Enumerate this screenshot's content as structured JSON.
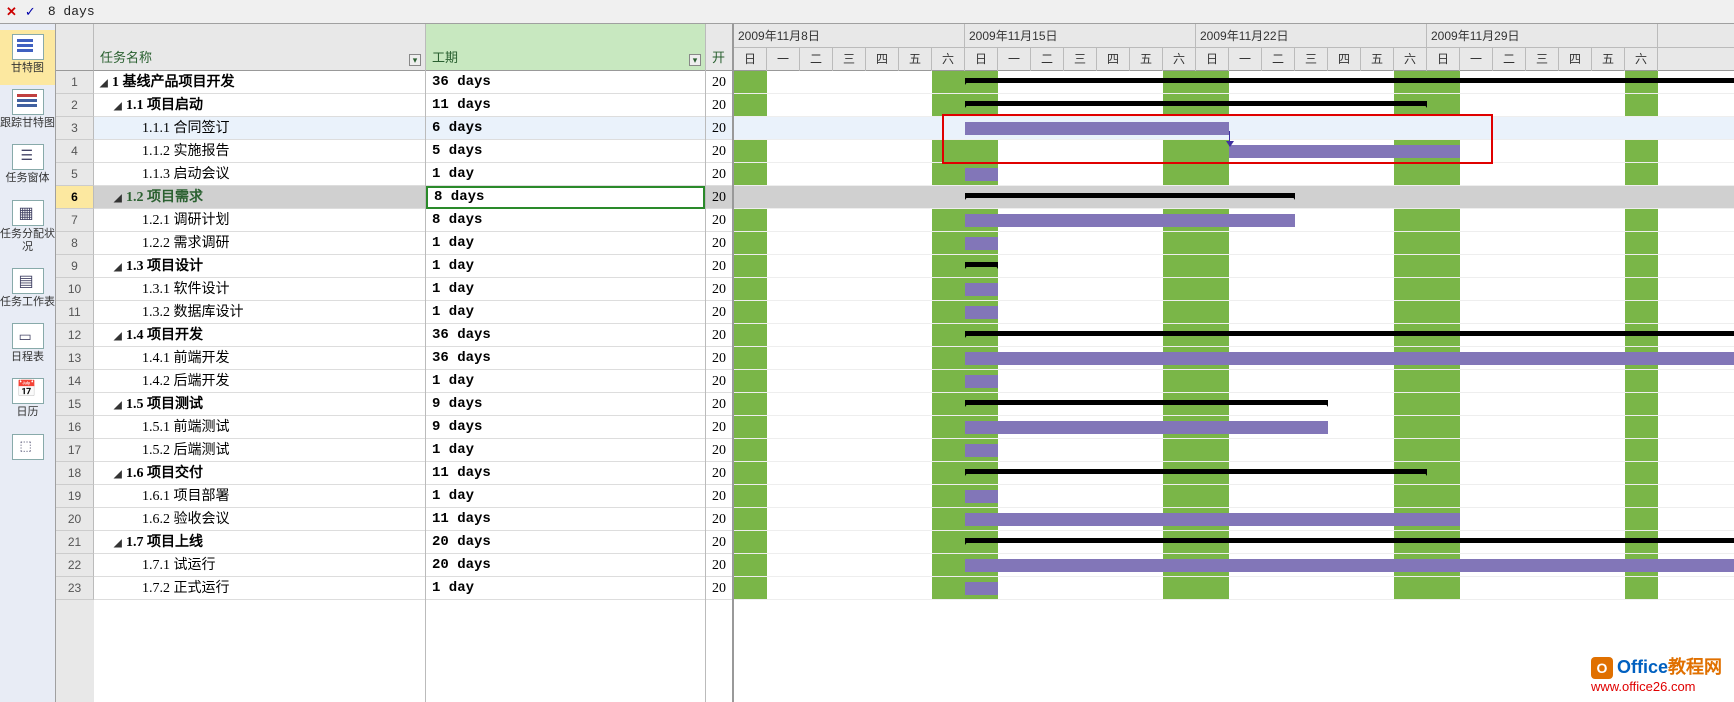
{
  "formula_bar": {
    "cancel": "✕",
    "confirm": "✓",
    "value": "8 days"
  },
  "sidebar": {
    "items": [
      {
        "label": "甘特图"
      },
      {
        "label": "跟踪甘特图"
      },
      {
        "label": "任务窗体"
      },
      {
        "label": "任务分配状况"
      },
      {
        "label": "任务工作表"
      },
      {
        "label": "日程表"
      },
      {
        "label": "日历"
      },
      {
        "label": ""
      }
    ]
  },
  "columns": {
    "name": "任务名称",
    "duration": "工期",
    "start": "开"
  },
  "timeline": {
    "weeks": [
      "2009年11月8日",
      "2009年11月15日",
      "2009年11月22日",
      "2009年11月29日"
    ],
    "days": [
      "日",
      "一",
      "二",
      "三",
      "四",
      "五",
      "六"
    ]
  },
  "selected_row": 6,
  "highlight_row": 3,
  "tasks": [
    {
      "row": 1,
      "wbs": "1",
      "name": "基线产品项目开发",
      "dur": "36 days",
      "start": "20",
      "level": 0,
      "summary": true,
      "bar": [
        7,
        39
      ]
    },
    {
      "row": 2,
      "wbs": "1.1",
      "name": "项目启动",
      "dur": "11 days",
      "start": "20",
      "level": 1,
      "summary": true,
      "bar": [
        7,
        21
      ]
    },
    {
      "row": 3,
      "wbs": "1.1.1",
      "name": "合同签订",
      "dur": "6 days",
      "start": "20",
      "level": 2,
      "summary": false,
      "bar": [
        7,
        15
      ]
    },
    {
      "row": 4,
      "wbs": "1.1.2",
      "name": "实施报告",
      "dur": "5 days",
      "start": "20",
      "level": 2,
      "summary": false,
      "bar": [
        15,
        22
      ]
    },
    {
      "row": 5,
      "wbs": "1.1.3",
      "name": "启动会议",
      "dur": "1 day",
      "start": "20",
      "level": 2,
      "summary": false,
      "bar": [
        7,
        8
      ]
    },
    {
      "row": 6,
      "wbs": "1.2",
      "name": "项目需求",
      "dur": "8 days",
      "start": "20",
      "level": 1,
      "summary": true,
      "bar": [
        7,
        17
      ]
    },
    {
      "row": 7,
      "wbs": "1.2.1",
      "name": "调研计划",
      "dur": "8 days",
      "start": "20",
      "level": 2,
      "summary": false,
      "bar": [
        7,
        17
      ]
    },
    {
      "row": 8,
      "wbs": "1.2.2",
      "name": "需求调研",
      "dur": "1 day",
      "start": "20",
      "level": 2,
      "summary": false,
      "bar": [
        7,
        8
      ]
    },
    {
      "row": 9,
      "wbs": "1.3",
      "name": "项目设计",
      "dur": "1 day",
      "start": "20",
      "level": 1,
      "summary": true,
      "bar": [
        7,
        8
      ]
    },
    {
      "row": 10,
      "wbs": "1.3.1",
      "name": "软件设计",
      "dur": "1 day",
      "start": "20",
      "level": 2,
      "summary": false,
      "bar": [
        7,
        8
      ]
    },
    {
      "row": 11,
      "wbs": "1.3.2",
      "name": "数据库设计",
      "dur": "1 day",
      "start": "20",
      "level": 2,
      "summary": false,
      "bar": [
        7,
        8
      ]
    },
    {
      "row": 12,
      "wbs": "1.4",
      "name": "项目开发",
      "dur": "36 days",
      "start": "20",
      "level": 1,
      "summary": true,
      "bar": [
        7,
        39
      ]
    },
    {
      "row": 13,
      "wbs": "1.4.1",
      "name": "前端开发",
      "dur": "36 days",
      "start": "20",
      "level": 2,
      "summary": false,
      "bar": [
        7,
        39
      ]
    },
    {
      "row": 14,
      "wbs": "1.4.2",
      "name": "后端开发",
      "dur": "1 day",
      "start": "20",
      "level": 2,
      "summary": false,
      "bar": [
        7,
        8
      ]
    },
    {
      "row": 15,
      "wbs": "1.5",
      "name": "项目测试",
      "dur": "9 days",
      "start": "20",
      "level": 1,
      "summary": true,
      "bar": [
        7,
        18
      ]
    },
    {
      "row": 16,
      "wbs": "1.5.1",
      "name": "前端测试",
      "dur": "9 days",
      "start": "20",
      "level": 2,
      "summary": false,
      "bar": [
        7,
        18
      ]
    },
    {
      "row": 17,
      "wbs": "1.5.2",
      "name": "后端测试",
      "dur": "1 day",
      "start": "20",
      "level": 2,
      "summary": false,
      "bar": [
        7,
        8
      ]
    },
    {
      "row": 18,
      "wbs": "1.6",
      "name": "项目交付",
      "dur": "11 days",
      "start": "20",
      "level": 1,
      "summary": true,
      "bar": [
        7,
        21
      ]
    },
    {
      "row": 19,
      "wbs": "1.6.1",
      "name": "项目部署",
      "dur": "1 day",
      "start": "20",
      "level": 2,
      "summary": false,
      "bar": [
        7,
        8
      ]
    },
    {
      "row": 20,
      "wbs": "1.6.2",
      "name": "验收会议",
      "dur": "11 days",
      "start": "20",
      "level": 2,
      "summary": false,
      "bar": [
        7,
        22
      ]
    },
    {
      "row": 21,
      "wbs": "1.7",
      "name": "项目上线",
      "dur": "20 days",
      "start": "20",
      "level": 1,
      "summary": true,
      "bar": [
        7,
        33
      ]
    },
    {
      "row": 22,
      "wbs": "1.7.1",
      "name": "试运行",
      "dur": "20 days",
      "start": "20",
      "level": 2,
      "summary": false,
      "bar": [
        7,
        33
      ]
    },
    {
      "row": 23,
      "wbs": "1.7.2",
      "name": "正式运行",
      "dur": "1 day",
      "start": "20",
      "level": 2,
      "summary": false,
      "bar": [
        7,
        8
      ]
    }
  ],
  "weekend_cols": [
    0,
    6,
    7,
    13,
    14,
    20,
    21,
    27
  ],
  "link": {
    "from_row": 3,
    "to_row": 4,
    "col": 15
  },
  "redbox": {
    "top_row": 3,
    "bottom_row": 4,
    "left_col": 6.3,
    "right_col": 23
  },
  "watermark": {
    "brand1": "Office",
    "brand2": "教程网",
    "url": "www.office26.com"
  },
  "chart_data": {
    "type": "gantt",
    "title": "基线产品项目开发",
    "x_unit": "day index from 2009-11-08",
    "tasks": [
      {
        "id": "1",
        "name": "基线产品项目开发",
        "start": 7,
        "end": 39,
        "summary": true
      },
      {
        "id": "1.1",
        "name": "项目启动",
        "start": 7,
        "end": 21,
        "summary": true
      },
      {
        "id": "1.1.1",
        "name": "合同签订",
        "start": 7,
        "end": 15
      },
      {
        "id": "1.1.2",
        "name": "实施报告",
        "start": 15,
        "end": 22,
        "depends_on": "1.1.1"
      },
      {
        "id": "1.1.3",
        "name": "启动会议",
        "start": 7,
        "end": 8
      },
      {
        "id": "1.2",
        "name": "项目需求",
        "start": 7,
        "end": 17,
        "summary": true
      },
      {
        "id": "1.2.1",
        "name": "调研计划",
        "start": 7,
        "end": 17
      },
      {
        "id": "1.2.2",
        "name": "需求调研",
        "start": 7,
        "end": 8
      },
      {
        "id": "1.3",
        "name": "项目设计",
        "start": 7,
        "end": 8,
        "summary": true
      },
      {
        "id": "1.3.1",
        "name": "软件设计",
        "start": 7,
        "end": 8
      },
      {
        "id": "1.3.2",
        "name": "数据库设计",
        "start": 7,
        "end": 8
      },
      {
        "id": "1.4",
        "name": "项目开发",
        "start": 7,
        "end": 39,
        "summary": true
      },
      {
        "id": "1.4.1",
        "name": "前端开发",
        "start": 7,
        "end": 39
      },
      {
        "id": "1.4.2",
        "name": "后端开发",
        "start": 7,
        "end": 8
      },
      {
        "id": "1.5",
        "name": "项目测试",
        "start": 7,
        "end": 18,
        "summary": true
      },
      {
        "id": "1.5.1",
        "name": "前端测试",
        "start": 7,
        "end": 18
      },
      {
        "id": "1.5.2",
        "name": "后端测试",
        "start": 7,
        "end": 8
      },
      {
        "id": "1.6",
        "name": "项目交付",
        "start": 7,
        "end": 21,
        "summary": true
      },
      {
        "id": "1.6.1",
        "name": "项目部署",
        "start": 7,
        "end": 8
      },
      {
        "id": "1.6.2",
        "name": "验收会议",
        "start": 7,
        "end": 22
      },
      {
        "id": "1.7",
        "name": "项目上线",
        "start": 7,
        "end": 33,
        "summary": true
      },
      {
        "id": "1.7.1",
        "name": "试运行",
        "start": 7,
        "end": 33
      },
      {
        "id": "1.7.2",
        "name": "正式运行",
        "start": 7,
        "end": 8
      }
    ]
  }
}
